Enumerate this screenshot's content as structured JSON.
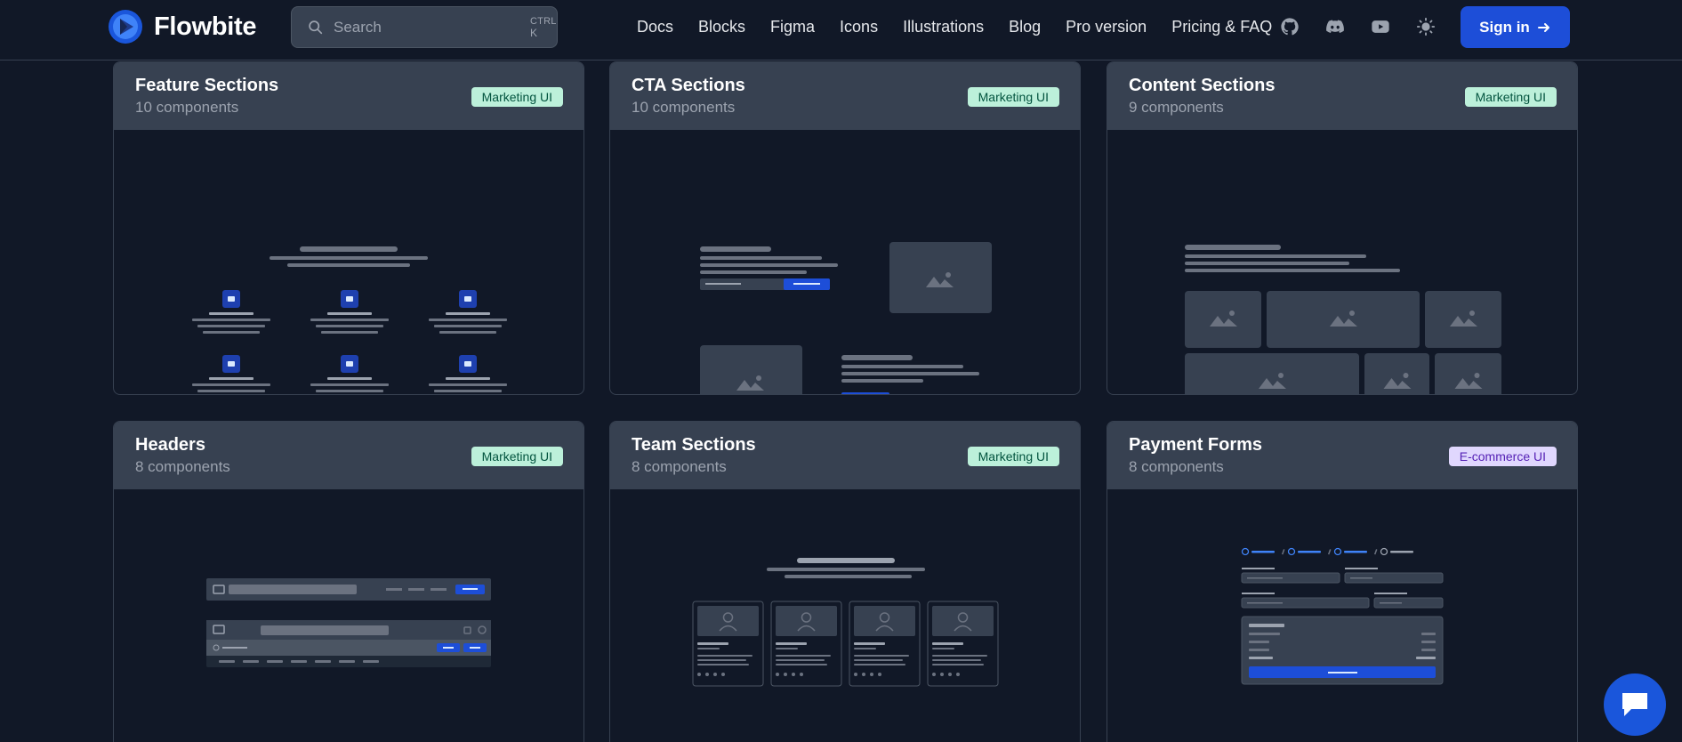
{
  "brand": {
    "name": "Flowbite",
    "logo_icon": "flowbite-logo-icon"
  },
  "search": {
    "placeholder": "Search",
    "shortcut_mod": "CTRL",
    "shortcut_key": "K",
    "icon": "search-icon"
  },
  "nav": {
    "links": [
      "Docs",
      "Blocks",
      "Figma",
      "Icons",
      "Illustrations",
      "Blog",
      "Pro version",
      "Pricing & FAQ"
    ],
    "icons": [
      "github-icon",
      "discord-icon",
      "youtube-icon",
      "sun-icon"
    ],
    "sign_in_label": "Sign in",
    "sign_in_icon": "arrow-right-icon"
  },
  "cards": [
    {
      "title": "Feature Sections",
      "count": "10 components",
      "badge": "Marketing UI",
      "badge_type": "marketing"
    },
    {
      "title": "CTA Sections",
      "count": "10 components",
      "badge": "Marketing UI",
      "badge_type": "marketing"
    },
    {
      "title": "Content Sections",
      "count": "9 components",
      "badge": "Marketing UI",
      "badge_type": "marketing"
    },
    {
      "title": "Headers",
      "count": "8 components",
      "badge": "Marketing UI",
      "badge_type": "marketing"
    },
    {
      "title": "Team Sections",
      "count": "8 components",
      "badge": "Marketing UI",
      "badge_type": "marketing"
    },
    {
      "title": "Payment Forms",
      "count": "8 components",
      "badge": "E-commerce UI",
      "badge_type": "ecommerce"
    }
  ],
  "colors": {
    "page_bg": "#111827",
    "card_header_bg": "#374151",
    "accent_blue": "#1d4ed8",
    "marketing_badge_bg": "#bcf0da",
    "marketing_badge_text": "#03543f",
    "ecommerce_badge_bg": "#e0d7fe",
    "ecommerce_badge_text": "#5521b5"
  },
  "chat_button": {
    "icon": "chat-bubble-icon"
  }
}
